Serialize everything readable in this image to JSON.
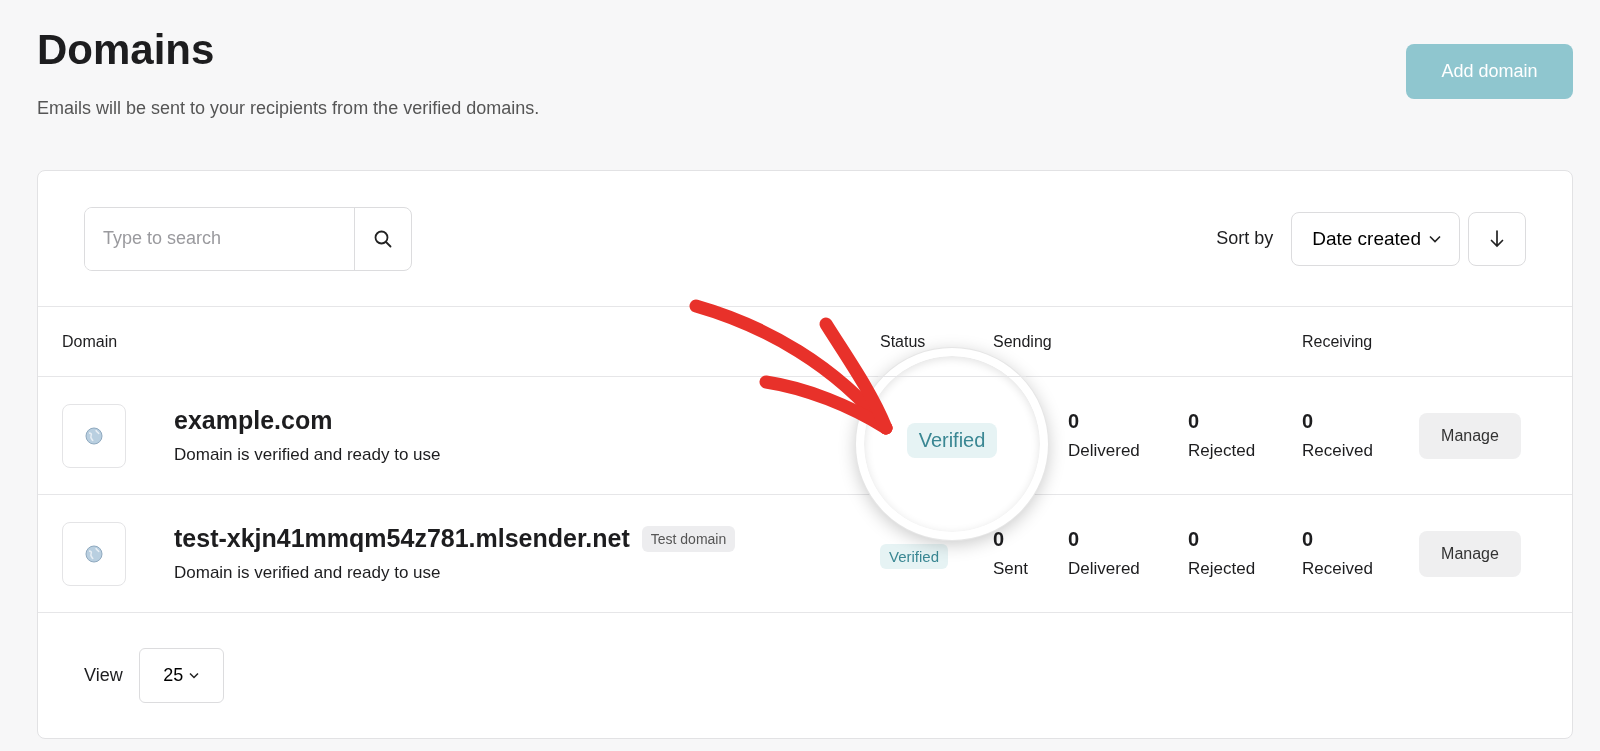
{
  "header": {
    "title": "Domains",
    "subtitle": "Emails will be sent to your recipients from the verified domains.",
    "add_button": "Add domain"
  },
  "toolbar": {
    "search": {
      "placeholder": "Type to search"
    },
    "sort_label": "Sort by",
    "sort_value": "Date created"
  },
  "table": {
    "columns": [
      "Domain",
      "Status",
      "Sending",
      "Receiving"
    ],
    "rows": [
      {
        "domain": "example.com",
        "description": "Domain is verified and ready to use",
        "delivered": "0",
        "delivered_label": "Delivered",
        "rejected": "0",
        "rejected_label": "Rejected",
        "received": "0",
        "received_label": "Received",
        "action": "Manage"
      },
      {
        "domain": "test-xkjn41mmqm54z781.mlsender.net",
        "tag": "Test domain",
        "description": "Domain is verified and ready to use",
        "status": "Verified",
        "sent": "0",
        "sent_label": "Sent",
        "delivered": "0",
        "delivered_label": "Delivered",
        "rejected": "0",
        "rejected_label": "Rejected",
        "received": "0",
        "received_label": "Received",
        "action": "Manage"
      }
    ]
  },
  "footer": {
    "view_label": "View",
    "page_size": "25"
  },
  "annotation": {
    "magnifier": {
      "status": "Verified"
    }
  }
}
